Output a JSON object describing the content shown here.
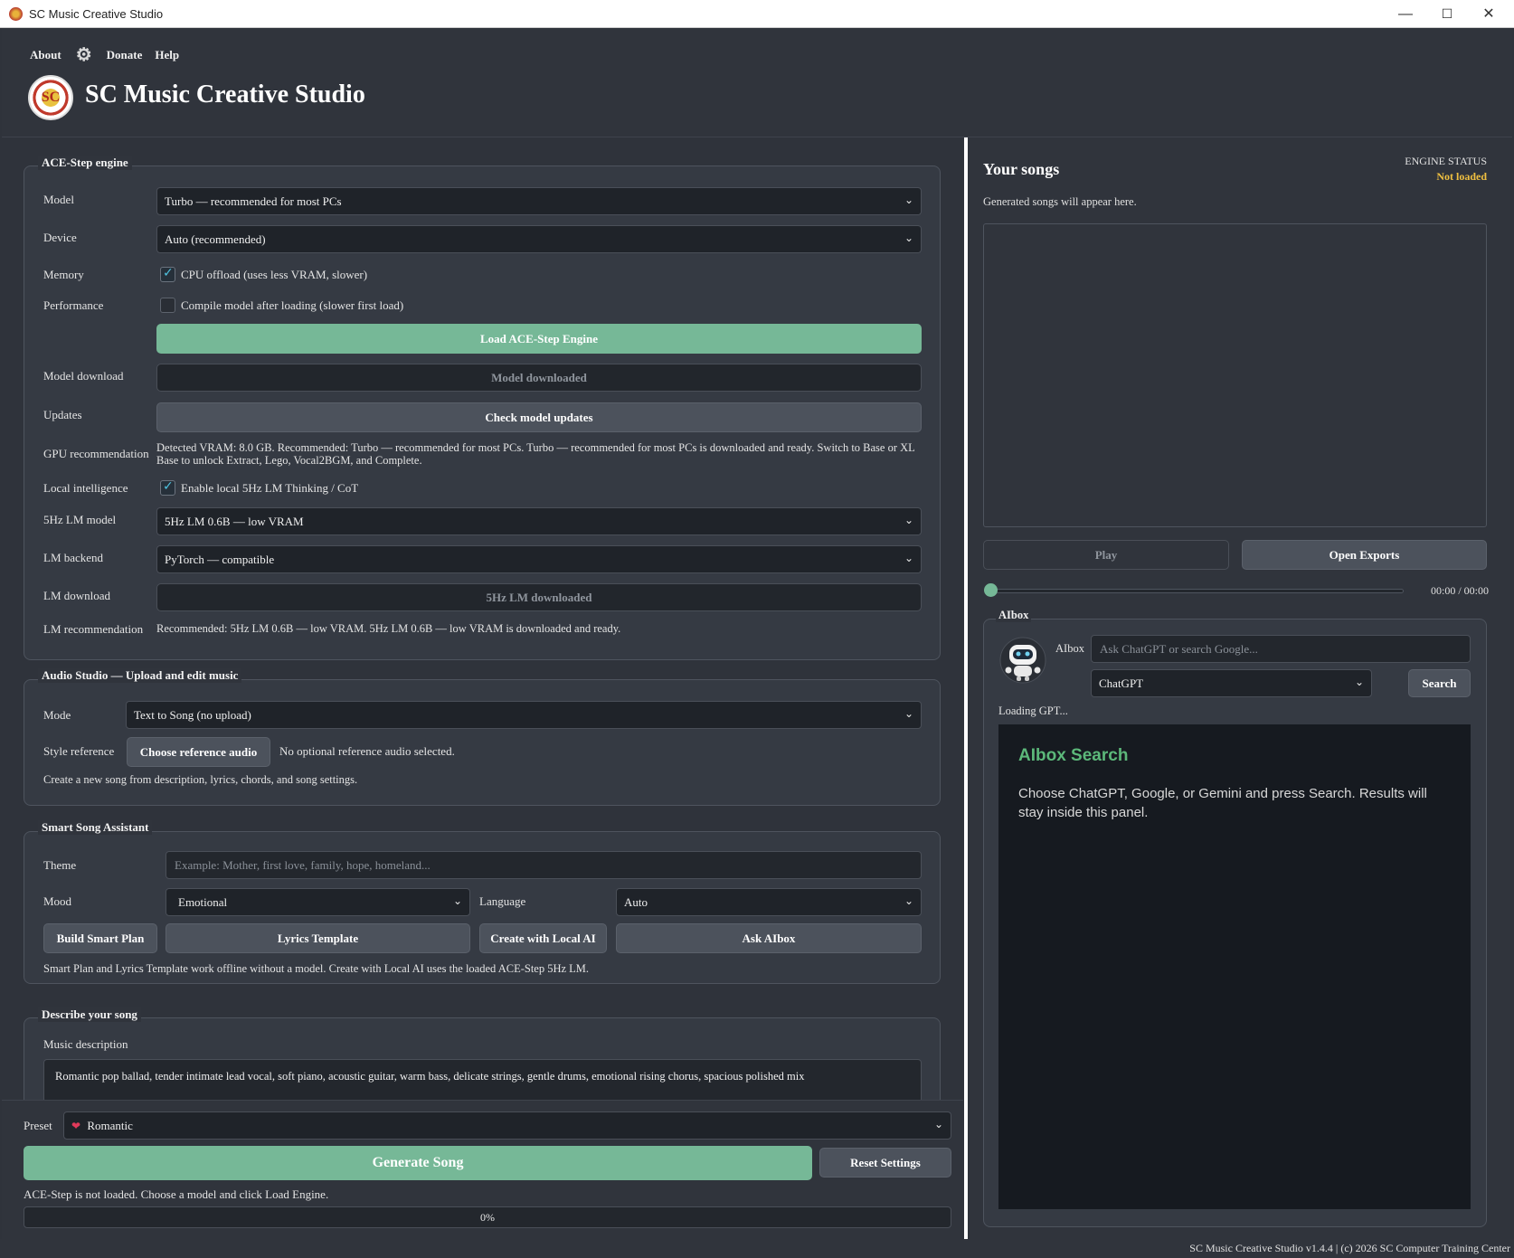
{
  "window": {
    "title": "SC Music Creative Studio",
    "minimize": "—",
    "maximize": "☐",
    "close": "✕"
  },
  "header": {
    "nav": {
      "about": "About",
      "donate": "Donate",
      "help": "Help"
    },
    "logo_text": "SC",
    "title": "SC Music Creative Studio"
  },
  "engine": {
    "title": "ACE-Step engine",
    "model_label": "Model",
    "model_value": "Turbo — recommended for most PCs",
    "device_label": "Device",
    "device_value": "Auto (recommended)",
    "memory_label": "Memory",
    "memory_checkbox": "CPU offload (uses less VRAM, slower)",
    "memory_checked": true,
    "performance_label": "Performance",
    "performance_checkbox": "Compile model after loading (slower first load)",
    "performance_checked": false,
    "load_button": "Load ACE-Step Engine",
    "model_download_label": "Model download",
    "model_download_button": "Model downloaded",
    "updates_label": "Updates",
    "updates_button": "Check model updates",
    "gpu_label": "GPU recommendation",
    "gpu_text": "Detected VRAM: 8.0 GB. Recommended: Turbo — recommended for most PCs. Turbo — recommended for most PCs is downloaded and ready. Switch to Base or XL Base to unlock Extract, Lego, Vocal2BGM, and Complete.",
    "local_label": "Local intelligence",
    "local_checkbox": "Enable local 5Hz LM Thinking / CoT",
    "local_checked": true,
    "lm_model_label": "5Hz LM model",
    "lm_model_value": "5Hz LM 0.6B — low VRAM",
    "lm_backend_label": "LM backend",
    "lm_backend_value": "PyTorch — compatible",
    "lm_download_label": "LM download",
    "lm_download_button": "5Hz LM downloaded",
    "lm_rec_label": "LM recommendation",
    "lm_rec_text": "Recommended: 5Hz LM 0.6B — low VRAM. 5Hz LM 0.6B — low VRAM is downloaded and ready."
  },
  "audio_studio": {
    "title": "Audio Studio — Upload and edit music",
    "mode_label": "Mode",
    "mode_value": "Text to Song (no upload)",
    "style_label": "Style reference",
    "style_button": "Choose reference audio",
    "style_status": "No optional reference audio selected.",
    "hint": "Create a new song from description, lyrics, chords, and song settings."
  },
  "assistant": {
    "title": "Smart Song Assistant",
    "theme_label": "Theme",
    "theme_placeholder": "Example: Mother, first love, family, hope, homeland...",
    "mood_label": "Mood",
    "mood_value": "Emotional",
    "language_label": "Language",
    "language_value": "Auto",
    "btn_plan": "Build Smart Plan",
    "btn_lyrics": "Lyrics Template",
    "btn_local": "Create with Local AI",
    "btn_ask": "Ask AIbox",
    "hint": "Smart Plan and Lyrics Template work offline without a model. Create with Local AI uses the loaded ACE-Step 5Hz LM."
  },
  "describe": {
    "title": "Describe your song",
    "music_label": "Music description",
    "music_value": "Romantic pop ballad, tender intimate lead vocal, soft piano, acoustic guitar, warm bass, delicate strings, gentle drums, emotional rising chorus, spacious polished mix"
  },
  "bottom": {
    "preset_label": "Preset",
    "preset_icon": "❤",
    "preset_value": "Romantic",
    "generate_button": "Generate Song",
    "reset_button": "Reset Settings",
    "status_text": "ACE-Step is not loaded. Choose a model and click Load Engine.",
    "progress_text": "0%",
    "progress": 0
  },
  "songs": {
    "title": "Your songs",
    "subtitle": "Generated songs will appear here.",
    "engine_status_label": "ENGINE STATUS",
    "engine_status_value": "Not loaded",
    "play_button": "Play",
    "exports_button": "Open Exports",
    "time": "00:00 / 00:00"
  },
  "aibox": {
    "title": "AIbox",
    "label": "AIbox",
    "search_placeholder": "Ask ChatGPT or search Google...",
    "provider_value": "ChatGPT",
    "search_button": "Search",
    "loading": "Loading GPT...",
    "result_title": "AIbox Search",
    "result_text": "Choose ChatGPT, Google, or Gemini and press Search. Results will stay inside this panel."
  },
  "footer": {
    "text": "SC Music Creative Studio v1.4.4 | (c) 2026 SC Computer Training Center"
  },
  "colors": {
    "accent_green": "#76b897",
    "status_yellow": "#f0c040",
    "aibox_title": "#5cb87a",
    "checkbox_tick": "#4fc3e0"
  },
  "icons": {
    "settings": "gear-icon",
    "checkbox": "checkmark-icon",
    "dropdown": "chevron-down-icon",
    "robot": "robot-icon",
    "preset": "heart-icon"
  }
}
